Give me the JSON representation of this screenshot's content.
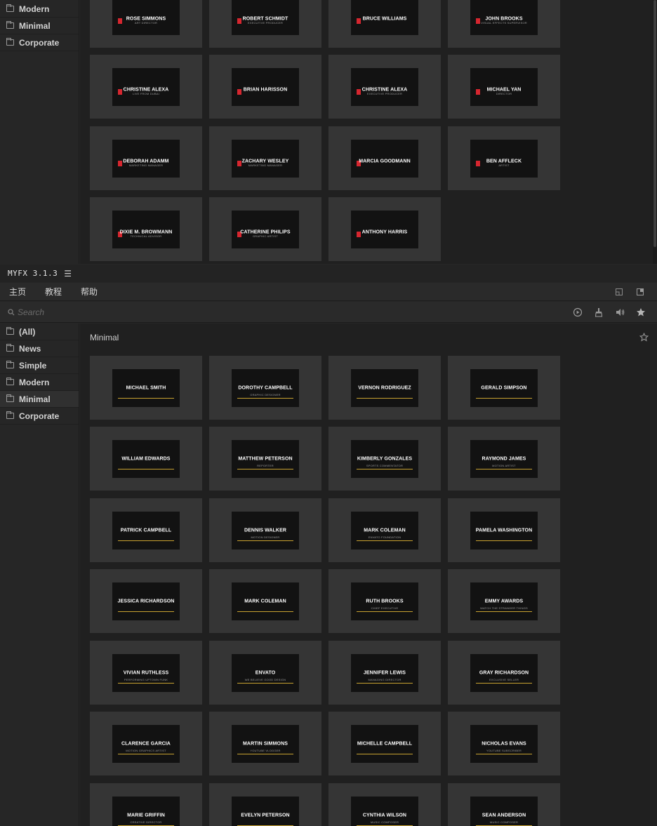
{
  "panel": {
    "title": "MYFX 3.1.3",
    "menu_icon": "hamburger-icon"
  },
  "tabs": [
    {
      "label": "主页"
    },
    {
      "label": "教程"
    },
    {
      "label": "帮助"
    }
  ],
  "search": {
    "placeholder": "Search",
    "value": ""
  },
  "top_sidebar": [
    {
      "label": "Modern"
    },
    {
      "label": "Minimal"
    },
    {
      "label": "Corporate"
    }
  ],
  "top_cards": [
    {
      "title": "ROSE SIMMONS",
      "subtitle": "ART DIRECTOR"
    },
    {
      "title": "ROBERT SCHMIDT",
      "subtitle": "EXECUTIVE PRODUCER"
    },
    {
      "title": "BRUCE WILLIAMS",
      "subtitle": ""
    },
    {
      "title": "JOHN BROOKS",
      "subtitle": "VISUAL EFFECTS SUPERVISOR"
    },
    {
      "title": "CHRISTINE ALEXA",
      "subtitle": "LIVE FROM DUBAI"
    },
    {
      "title": "BRIAN HARISSON",
      "subtitle": ""
    },
    {
      "title": "CHRISTINE ALEXA",
      "subtitle": "EXECUTIVE PRODUCER"
    },
    {
      "title": "MICHAEL YAN",
      "subtitle": "DIRECTOR"
    },
    {
      "title": "DEBORAH ADAMM",
      "subtitle": "MARKETING MANAGER"
    },
    {
      "title": "ZACHARY WESLEY",
      "subtitle": "MARKETING MANAGER"
    },
    {
      "title": "MARCIA GOODMANN",
      "subtitle": ""
    },
    {
      "title": "BEN AFFLECK",
      "subtitle": "ARTIST"
    },
    {
      "title": "DIXIE M. BROWMANN",
      "subtitle": "TECHNICAL ADVISOR"
    },
    {
      "title": "CATHERINE PHILIPS",
      "subtitle": "GRAPHIC ARTIST"
    },
    {
      "title": "ANTHONY HARRIS",
      "subtitle": ""
    }
  ],
  "bottom_sidebar": [
    {
      "label": "(All)"
    },
    {
      "label": "News"
    },
    {
      "label": "Simple"
    },
    {
      "label": "Modern"
    },
    {
      "label": "Minimal"
    },
    {
      "label": "Corporate"
    }
  ],
  "section": {
    "title": "Minimal"
  },
  "bottom_cards": [
    {
      "title": "MICHAEL SMITH",
      "subtitle": ""
    },
    {
      "title": "DOROTHY CAMPBELL",
      "subtitle": "GRAPHIC DESIGNER"
    },
    {
      "title": "VERNON RODRIGUEZ",
      "subtitle": ""
    },
    {
      "title": "GERALD SIMPSON",
      "subtitle": ""
    },
    {
      "title": "WILLIAM EDWARDS",
      "subtitle": ""
    },
    {
      "title": "MATTHEW PETERSON",
      "subtitle": "REPORTER"
    },
    {
      "title": "KIMBERLY GONZALES",
      "subtitle": "SPORTS COMMENTATOR"
    },
    {
      "title": "RAYMOND JAMES",
      "subtitle": "MOTION ARTIST"
    },
    {
      "title": "PATRICK CAMPBELL",
      "subtitle": ""
    },
    {
      "title": "DENNIS WALKER",
      "subtitle": "MOTION DESIGNER"
    },
    {
      "title": "MARK COLEMAN",
      "subtitle": "ENVATO FOUNDATION"
    },
    {
      "title": "PAMELA WASHINGTON",
      "subtitle": ""
    },
    {
      "title": "JESSICA RICHARDSON",
      "subtitle": ""
    },
    {
      "title": "MARK COLEMAN",
      "subtitle": ""
    },
    {
      "title": "RUTH BROOKS",
      "subtitle": "CHIEF EXECUTIVE"
    },
    {
      "title": "EMMY AWARDS",
      "subtitle": "WATCH THE STRANGER THINGS"
    },
    {
      "title": "VIVIAN RUTHLESS",
      "subtitle": "PERFORMING UPTOWN FUNK"
    },
    {
      "title": "ENVATO",
      "subtitle": "WE BELIEVE GOOD DESIGN"
    },
    {
      "title": "JENNIFER LEWIS",
      "subtitle": "MANAGING DIRECTOR"
    },
    {
      "title": "GRAY RICHARDSON",
      "subtitle": "EXCLUSIVE SELLER"
    },
    {
      "title": "CLARENCE GARCIA",
      "subtitle": "MOTION GRAPHICS ARTIST"
    },
    {
      "title": "MARTIN SIMMONS",
      "subtitle": "YOUTUBE VLOGGER"
    },
    {
      "title": "MICHELLE CAMPBELL",
      "subtitle": ""
    },
    {
      "title": "NICHOLAS EVANS",
      "subtitle": "YOUTUBE SUBSCRIBER"
    },
    {
      "title": "MARIE GRIFFIN",
      "subtitle": "CREATIVE DIRECTOR"
    },
    {
      "title": "EVELYN PETERSON",
      "subtitle": ""
    },
    {
      "title": "CYNTHIA WILSON",
      "subtitle": "MUSIC COMPOSER"
    },
    {
      "title": "SEAN ANDERSON",
      "subtitle": "MUSIC COMPOSER"
    }
  ],
  "colors": {
    "accent_red": "#d6262f",
    "accent_gold": "#c8a230",
    "panel_bg": "#262626",
    "grid_bg": "#202020",
    "card_bg": "#353535"
  }
}
